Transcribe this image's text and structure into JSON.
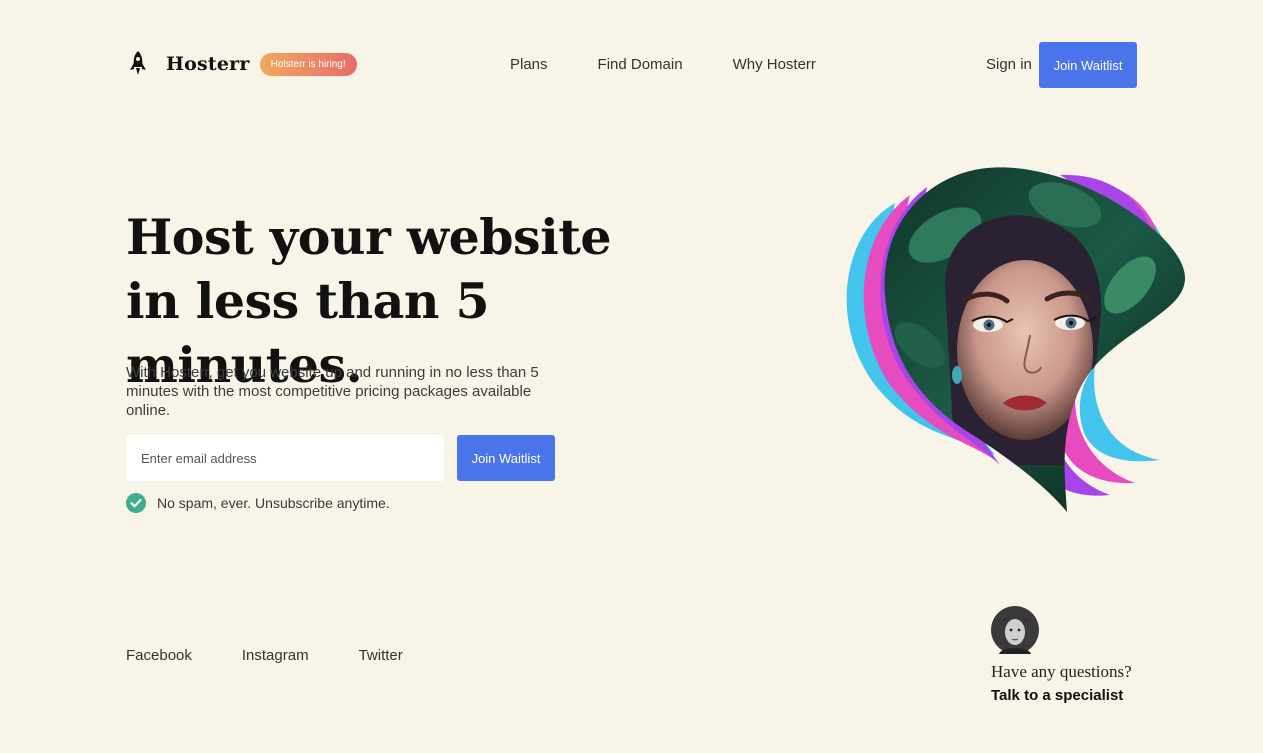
{
  "header": {
    "brand": "Hosterr",
    "hiring_badge": "Holsterr is hiring!",
    "nav": [
      {
        "label": "Plans"
      },
      {
        "label": "Find Domain"
      },
      {
        "label": "Why Hosterr"
      }
    ],
    "sign_in": "Sign in",
    "cta": "Join Waitlist"
  },
  "hero": {
    "title": "Host your website in less than 5 minutes.",
    "subtitle": "With Hosterr, get you website up and running in no less than 5 minutes with the most competitive pricing packages available online.",
    "email_placeholder": "Enter email address",
    "cta": "Join Waitlist",
    "no_spam": "No spam, ever. Unsubscribe anytime."
  },
  "footer": {
    "socials": [
      {
        "label": "Facebook"
      },
      {
        "label": "Instagram"
      },
      {
        "label": "Twitter"
      }
    ],
    "question": "Have any questions?",
    "talk": "Talk to a specialist"
  },
  "colors": {
    "background": "#f8f4e8",
    "accent": "#4a74ea",
    "check": "#3fae8c",
    "badge_start": "#f0a95c",
    "badge_end": "#e96b6b",
    "wave_cyan": "#43c4ec",
    "wave_pink": "#e64bc0",
    "wave_purple": "#a745e8"
  },
  "icons": {
    "logo": "rocket-icon",
    "check": "check-circle-icon"
  }
}
